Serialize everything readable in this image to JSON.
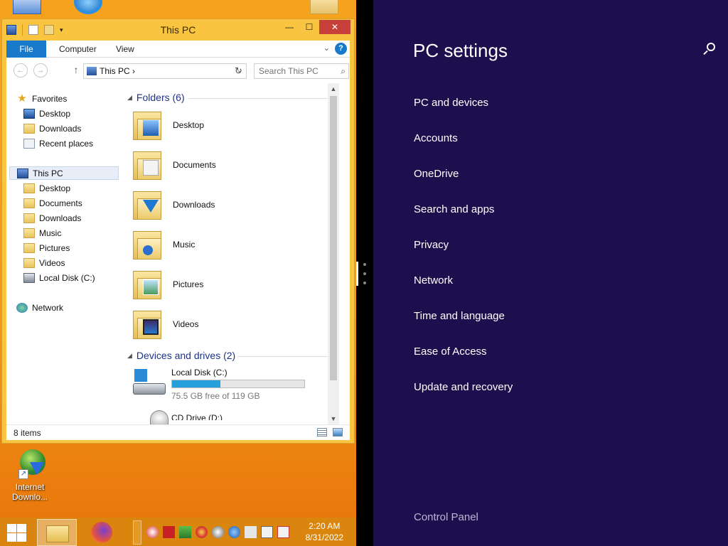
{
  "desktop": {
    "icons": [
      {
        "label": "Internet Downlo...",
        "icon": "internet-download-manager-icon"
      }
    ]
  },
  "explorer": {
    "title": "This PC",
    "ribbon_tabs": [
      {
        "label": "File"
      },
      {
        "label": "Computer"
      },
      {
        "label": "View"
      }
    ],
    "help_label": "?",
    "address": {
      "breadcrumb": "This PC",
      "separator": "›",
      "search_placeholder": "Search This PC"
    },
    "nav": {
      "favorites": {
        "label": "Favorites",
        "items": [
          "Desktop",
          "Downloads",
          "Recent places"
        ]
      },
      "this_pc": {
        "label": "This PC",
        "items": [
          "Desktop",
          "Documents",
          "Downloads",
          "Music",
          "Pictures",
          "Videos",
          "Local Disk (C:)"
        ]
      },
      "network": {
        "label": "Network"
      }
    },
    "folders_header": "Folders (6)",
    "folders": [
      "Desktop",
      "Documents",
      "Downloads",
      "Music",
      "Pictures",
      "Videos"
    ],
    "devices_header": "Devices and drives (2)",
    "drives": [
      {
        "name": "Local Disk (C:)",
        "free_text": "75.5 GB free of 119 GB",
        "used_fraction": 0.366
      },
      {
        "name": "CD Drive (D:)"
      }
    ],
    "status": {
      "item_count": "8 items"
    }
  },
  "settings": {
    "title": "PC settings",
    "items": [
      "PC and devices",
      "Accounts",
      "OneDrive",
      "Search and apps",
      "Privacy",
      "Network",
      "Time and language",
      "Ease of Access",
      "Update and recovery"
    ],
    "control_panel": "Control Panel"
  },
  "taskbar": {
    "time": "2:20 AM",
    "date": "8/31/2022"
  },
  "colors": {
    "settings_bg": "#1d0e4d",
    "accent_blue": "#1979ca",
    "desktop_orange": "#f39a18",
    "drive_bar": "#26a0da"
  }
}
